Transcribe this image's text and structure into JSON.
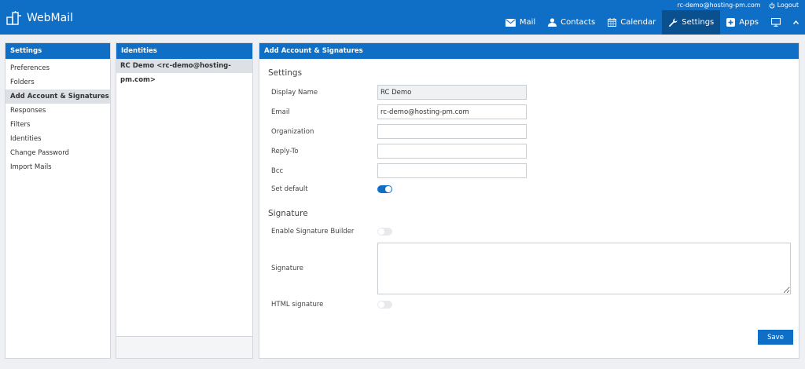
{
  "header": {
    "user_email": "rc-demo@hosting-pm.com",
    "logout_label": "Logout",
    "app_name": "WebMail",
    "nav": [
      {
        "label": "Mail",
        "icon": "envelope-icon"
      },
      {
        "label": "Contacts",
        "icon": "person-icon"
      },
      {
        "label": "Calendar",
        "icon": "calendar-icon"
      },
      {
        "label": "Settings",
        "icon": "wrench-icon",
        "active": true
      },
      {
        "label": "Apps",
        "icon": "plus-square-icon"
      }
    ]
  },
  "settings_panel": {
    "title": "Settings",
    "items": [
      "Preferences",
      "Folders",
      "Add Account & Signatures",
      "Responses",
      "Filters",
      "Identities",
      "Change Password",
      "Import Mails"
    ],
    "active_index": 2
  },
  "identities_panel": {
    "title": "Identities",
    "items": [
      "RC Demo <rc-demo@hosting-pm.com>"
    ]
  },
  "main_panel": {
    "title": "Add Account & Signatures",
    "settings_section": "Settings",
    "fields": {
      "display_name": {
        "label": "Display Name",
        "value": "RC Demo"
      },
      "email": {
        "label": "Email",
        "value": "rc-demo@hosting-pm.com"
      },
      "organization": {
        "label": "Organization",
        "value": ""
      },
      "reply_to": {
        "label": "Reply-To",
        "value": ""
      },
      "bcc": {
        "label": "Bcc",
        "value": ""
      }
    },
    "set_default": {
      "label": "Set default",
      "on": true
    },
    "signature_section": "Signature",
    "enable_builder": {
      "label": "Enable Signature Builder",
      "on": false
    },
    "signature": {
      "label": "Signature",
      "value": ""
    },
    "html_signature": {
      "label": "HTML signature",
      "on": false
    },
    "save_label": "Save"
  },
  "colors": {
    "accent": "#0f6fc6",
    "active_nav": "#0a4f8e"
  }
}
